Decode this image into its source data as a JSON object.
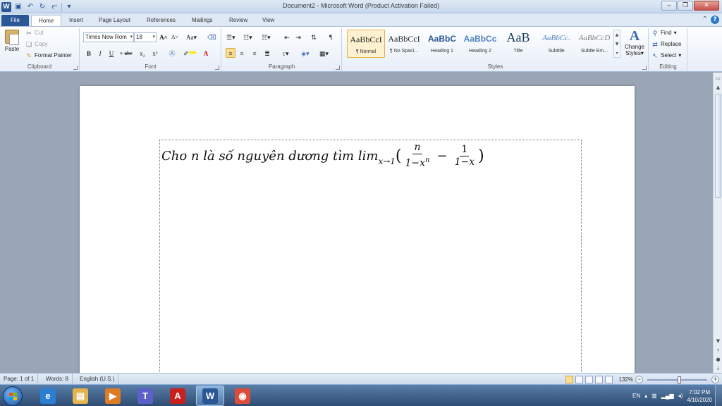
{
  "window": {
    "title": "Document2 - Microsoft Word (Product Activation Failed)",
    "app_icon_letter": "W"
  },
  "tabs": [
    {
      "label": "File"
    },
    {
      "label": "Home"
    },
    {
      "label": "Insert"
    },
    {
      "label": "Page Layout"
    },
    {
      "label": "References"
    },
    {
      "label": "Mailings"
    },
    {
      "label": "Review"
    },
    {
      "label": "View"
    }
  ],
  "ribbon": {
    "clipboard": {
      "label": "Clipboard",
      "paste": "Paste",
      "cut": "Cut",
      "copy": "Copy",
      "format_painter": "Format Painter"
    },
    "font": {
      "label": "Font",
      "font_name": "Times New Rom",
      "font_size": "18",
      "bold": "B",
      "italic": "I",
      "underline": "U",
      "strikethrough": "abc",
      "subscript": "x₂",
      "superscript": "x²",
      "grow": "A",
      "shrink": "A",
      "change_case": "Aa",
      "font_color": "A"
    },
    "paragraph": {
      "label": "Paragraph",
      "pilcrow": "¶"
    },
    "styles": {
      "label": "Styles",
      "items": [
        {
          "preview": "AaBbCcI",
          "name": "¶ Normal"
        },
        {
          "preview": "AaBbCcI",
          "name": "¶ No Spaci..."
        },
        {
          "preview": "AaBbC",
          "name": "Heading 1"
        },
        {
          "preview": "AaBbCc",
          "name": "Heading 2"
        },
        {
          "preview": "AaB",
          "name": "Title"
        },
        {
          "preview": "AaBbCc.",
          "name": "Subtitle"
        },
        {
          "preview": "AaBbCcD",
          "name": "Subtle Em..."
        }
      ],
      "change_styles": "Change Styles",
      "change_styles_l1": "Change",
      "change_styles_l2": "Styles"
    },
    "editing": {
      "label": "Editing",
      "find": "Find",
      "replace": "Replace",
      "select": "Select"
    }
  },
  "document": {
    "text_prefix": "Cho n là số nguyên dương tìm ",
    "lim": "lim",
    "lim_sub": "x→1",
    "open_paren": "(",
    "frac1_num": "n",
    "frac1_den_base": "1−x",
    "frac1_den_exp": "n",
    "minus": "−",
    "frac2_num": "1",
    "frac2_den": "1−x",
    "close_paren": ")"
  },
  "statusbar": {
    "page": "Page: 1 of 1",
    "words": "Words: 8",
    "language": "English (U.S.)",
    "zoom": "132%",
    "zoom_value_percent": 132
  },
  "taskbar": {
    "apps": [
      {
        "name": "ie",
        "glyph": "e",
        "color": "#2a7fd4"
      },
      {
        "name": "explorer",
        "glyph": "▤",
        "color": "#e4b34c"
      },
      {
        "name": "media",
        "glyph": "▶",
        "color": "#e07b25"
      },
      {
        "name": "teams",
        "glyph": "T",
        "color": "#5b5fc7"
      },
      {
        "name": "acrobat",
        "glyph": "A",
        "color": "#c8201e"
      },
      {
        "name": "word",
        "glyph": "W",
        "color": "#2b5797"
      },
      {
        "name": "chrome",
        "glyph": "◉",
        "color": "#dd4b39"
      }
    ],
    "lang": "EN",
    "time": "7:02 PM",
    "date": "4/10/2020"
  }
}
